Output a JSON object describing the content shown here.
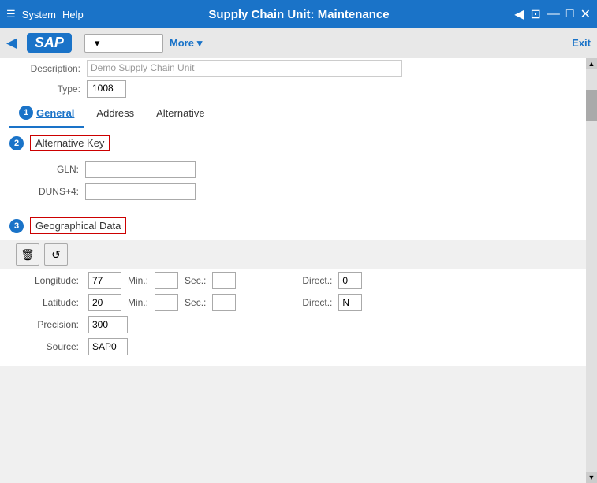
{
  "titlebar": {
    "hamburger": "☰",
    "menu": [
      "System",
      "Help"
    ],
    "title": "Supply Chain Unit: Maintenance",
    "controls": {
      "back": "◀",
      "restore": "⊡",
      "minimize": "—",
      "maximize": "□",
      "close": "✕"
    }
  },
  "toolbar": {
    "back_arrow": "◀",
    "sap_logo": "SAP",
    "dropdown_placeholder": "",
    "more_label": "More",
    "more_arrow": "▾",
    "exit_label": "Exit"
  },
  "description": {
    "label": "Description:",
    "value": "Demo Supply Chain Unit"
  },
  "type": {
    "label": "Type:",
    "value": "1008"
  },
  "tabs": [
    {
      "id": "general",
      "label": "General",
      "active": true,
      "number": "1"
    },
    {
      "id": "address",
      "label": "Address",
      "active": false
    },
    {
      "id": "alternative",
      "label": "Alternative",
      "active": false
    }
  ],
  "sections": {
    "alternative_key": {
      "number": "2",
      "title": "Alternative Key",
      "fields": [
        {
          "label": "GLN:",
          "value": "",
          "id": "gln"
        },
        {
          "label": "DUNS+4:",
          "value": "",
          "id": "duns4"
        }
      ]
    },
    "geographical_data": {
      "number": "3",
      "title": "Geographical Data",
      "buttons": {
        "delete": "🗑",
        "refresh": "↺"
      },
      "rows": [
        {
          "label": "Longitude:",
          "value": "77",
          "min_label": "Min.:",
          "min_value": "",
          "sec_label": "Sec.:",
          "sec_value": "",
          "dir_label": "Direct.:",
          "dir_value": "0"
        },
        {
          "label": "Latitude:",
          "value": "20",
          "min_label": "Min.:",
          "min_value": "",
          "sec_label": "Sec.:",
          "sec_value": "",
          "dir_label": "Direct.:",
          "dir_value": "N"
        }
      ],
      "extra_fields": [
        {
          "label": "Precision:",
          "value": "300"
        },
        {
          "label": "Source:",
          "value": "SAP0"
        }
      ]
    }
  },
  "scrollbar": {
    "up_arrow": "▲",
    "down_arrow": "▼"
  }
}
